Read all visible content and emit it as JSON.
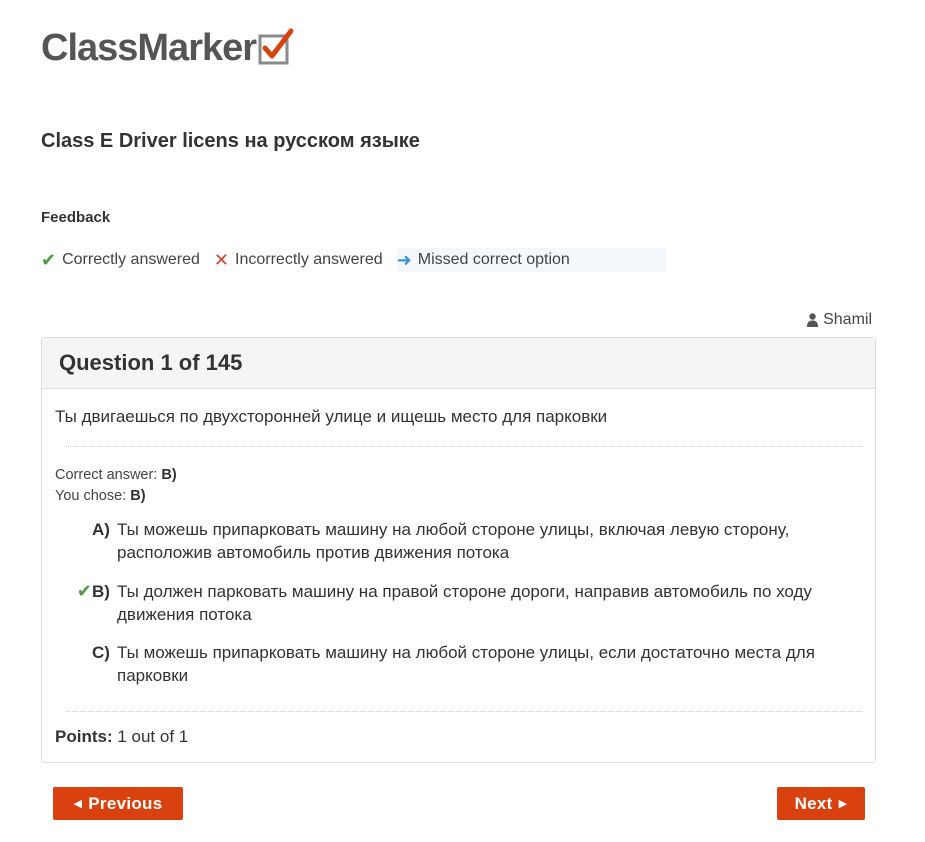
{
  "brand": {
    "name": "ClassMarker"
  },
  "quiz": {
    "title": "Class E Driver licens на русском языке"
  },
  "feedback": {
    "heading": "Feedback",
    "legend": [
      {
        "icon": "check-icon",
        "label": "Correctly answered",
        "color": "#4a9c3f"
      },
      {
        "icon": "x-icon",
        "label": "Incorrectly answered",
        "color": "#d9412a"
      },
      {
        "icon": "arrow-right-icon",
        "label": "Missed correct option",
        "color": "#3d8fd6"
      }
    ]
  },
  "user": {
    "name": "Shamil",
    "icon": "user-icon"
  },
  "question": {
    "heading": "Question 1 of 145",
    "text": "Ты двигаешься по двухсторонней улице и ищешь место для парковки",
    "correct_answer_label": "Correct answer:",
    "correct_answer_value": "B)",
    "you_chose_label": "You chose:",
    "you_chose_value": "B)",
    "options": [
      {
        "letter": "A)",
        "text": "Ты можешь припарковать машину на любой стороне улицы, включая левую сторону, расположив автомобиль против движения потока",
        "mark": ""
      },
      {
        "letter": "B)",
        "text": "Ты должен парковать машину на правой стороне дороги, направив автомобиль по ходу движения потока",
        "mark": "check-icon"
      },
      {
        "letter": "C)",
        "text": "Ты можешь припарковать машину на любой стороне улицы, если достаточно места для парковки",
        "mark": ""
      }
    ],
    "points_label": "Points:",
    "points_value": "1 out of 1"
  },
  "nav": {
    "previous_label": "Previous",
    "next_label": "Next",
    "accent": "#d9410f"
  }
}
